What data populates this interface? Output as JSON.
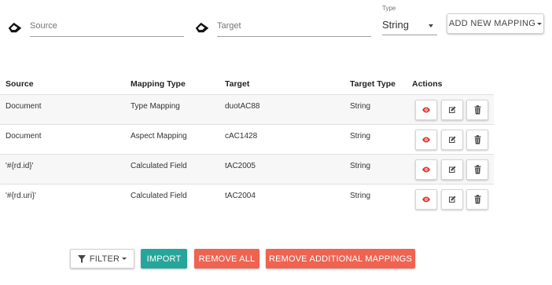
{
  "form": {
    "source_placeholder": "Source",
    "target_placeholder": "Target",
    "type_label": "Type",
    "type_value": "String",
    "add_button_label": "ADD NEW MAPPING"
  },
  "table": {
    "headers": [
      "Source",
      "Mapping Type",
      "Target",
      "Target Type",
      "Actions"
    ],
    "rows": [
      {
        "source": "Document",
        "mapping_type": "Type Mapping",
        "target": "duotAC88",
        "target_type": "String"
      },
      {
        "source": "Document",
        "mapping_type": "Aspect Mapping",
        "target": "cAC1428",
        "target_type": "String"
      },
      {
        "source": "'#{rd.id}'",
        "mapping_type": "Calculated Field",
        "target": "tAC2005",
        "target_type": "String"
      },
      {
        "source": "'#{rd.uri}'",
        "mapping_type": "Calculated Field",
        "target": "tAC2004",
        "target_type": "String"
      }
    ],
    "row_action_icons": [
      "eye-icon",
      "edit-icon",
      "trash-icon"
    ]
  },
  "footer": {
    "filter_label": "FILTER",
    "import_label": "IMPORT",
    "remove_all_label": "REMOVE ALL",
    "remove_additional_label": "REMOVE ADDITIONAL MAPPINGS"
  },
  "colors": {
    "import": "#26a69a",
    "remove": "#ef6351",
    "eye_icon": "#e53935"
  }
}
